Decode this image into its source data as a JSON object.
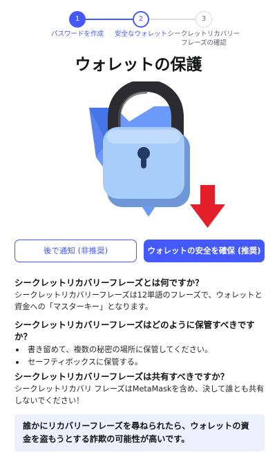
{
  "stepper": {
    "steps": [
      {
        "number": "1",
        "label": "パスワードを作成",
        "state": "completed"
      },
      {
        "number": "2",
        "label": "安全なウォレット",
        "state": "active"
      },
      {
        "number": "3",
        "label": "シークレットリカバリー\nフレーズの確認",
        "state": "pending"
      }
    ]
  },
  "page_title": "ウォレットの保護",
  "illustration": {
    "icon": "padlock-icon",
    "arrow_icon": "down-arrow-icon",
    "colors": {
      "lock_body": "#a8cdfb",
      "shackle": "#2b2b30",
      "background_shape": "#5b8ff9",
      "arrow": "#e3202a"
    }
  },
  "buttons": {
    "remind_later": "後で通知 (非推奨)",
    "secure_wallet": "ウォレットの安全を確保 (推奨)"
  },
  "sections": [
    {
      "heading": "シークレットリカバリーフレーズとは何ですか？",
      "body": "シークレットリカバリーフレーズは12単語のフレーズで、ウォレットと資金への「マスターキー」となります。"
    },
    {
      "heading": "シークレットリカバリーフレーズはどのように保管すべきですか？",
      "bullets": [
        "書き留めて、複数の秘密の場所に保管してください。",
        "セーフティボックスに保管する。"
      ]
    },
    {
      "heading": "シークレットリカバリーフレーズは共有すべきですか？",
      "body": "シークレットリカバリ フレーズはMetaMaskを含め、決して誰とも共有しないでください！"
    }
  ],
  "warning": "誰かにリカバリーフレーズを尋ねられたら、ウォレットの資金を盗もうとする詐欺の可能性が高いです。",
  "colors": {
    "accent": "#4459ff",
    "warning_bg": "#eef0ff"
  }
}
